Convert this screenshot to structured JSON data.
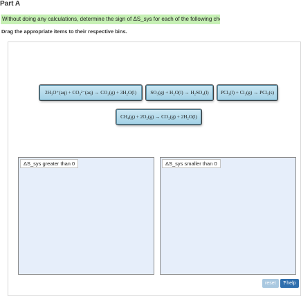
{
  "part": {
    "title": "Part A"
  },
  "prompt": {
    "text": "Without doing any calculations, determine the sign of ΔS_sys for each of the following chemical reactions."
  },
  "instruction": {
    "text": "Drag the appropriate items to their respective bins."
  },
  "items": [
    {
      "label": "2H₃O⁺(aq) + CO₃²⁻(aq) → CO₂(g) + 3H₂O(l)"
    },
    {
      "label": "SO₃(g) + H₂O(l) → H₂SO₄(l)"
    },
    {
      "label": "PCl₃(l) + Cl₂(g) → PCl₅(s)"
    },
    {
      "label": "CH₄(g) + 2O₂(g) → CO₂(g) + 2H₂O(l)"
    }
  ],
  "bins": [
    {
      "label": "ΔS_sys greater than 0"
    },
    {
      "label": "ΔS_sys smaller than 0"
    }
  ],
  "buttons": {
    "reset": "reset",
    "help": "help",
    "help_icon": "?"
  },
  "colors": {
    "prompt_highlight": "#c6f0b4",
    "item_fill": "#a3d2e6",
    "bin_fill": "#e6eefa",
    "help_button": "#2f6fae",
    "reset_button": "#a9c8e0"
  }
}
